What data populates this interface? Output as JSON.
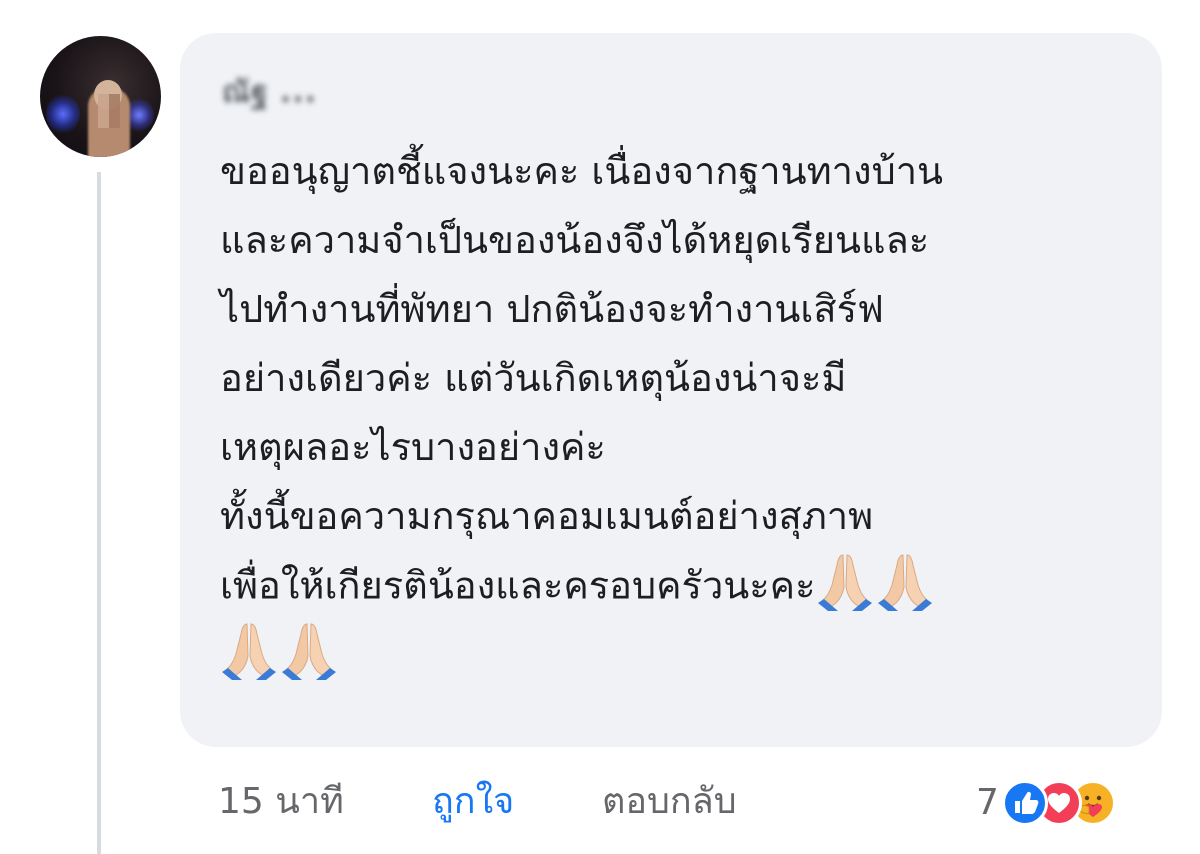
{
  "comment": {
    "author_name": "ณัฐ  ...",
    "lines": [
      "ขออนุญาตชี้แจงนะคะ เนื่องจากฐานทางบ้าน",
      "และความจำเป็นของน้องจึงได้หยุดเรียนและ",
      "ไปทำงานที่พัทยา ปกติน้องจะทำงานเสิร์ฟ",
      "อย่างเดียวค่ะ แต่วันเกิดเหตุน้องน่าจะมี",
      "เหตุผลอะไรบางอย่างค่ะ",
      "ทั้งนี้ขอความกรุณาคอมเมนต์อย่างสุภาพ",
      "เพื่อให้เกียรติน้องและครอบครัวนะคะ"
    ],
    "emoji": "folded-hands-icon"
  },
  "footer": {
    "time": "15 นาที",
    "like_label": "ถูกใจ",
    "reply_label": "ตอบกลับ",
    "reaction_count": "7",
    "reactions": [
      "like-reaction-icon",
      "love-reaction-icon",
      "care-reaction-icon"
    ]
  },
  "colors": {
    "bubble_bg": "#f0f2f5",
    "like_blue": "#1877f2",
    "meta_gray": "#65676b",
    "text": "#1c1e21"
  }
}
